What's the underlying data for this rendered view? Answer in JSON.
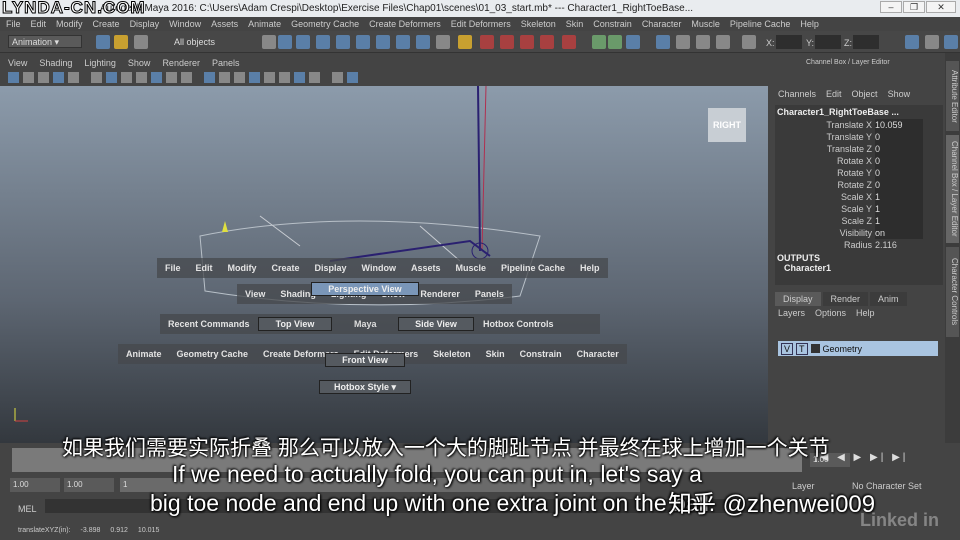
{
  "watermark": "LYNDA-CN.COM",
  "title": "Autodesk Maya 2016: C:\\Users\\Adam Crespi\\Desktop\\Exercise Files\\Chap01\\scenes\\01_03_start.mb*  ---  Character1_RightToeBase...",
  "window_buttons": [
    "–",
    "❐",
    "✕"
  ],
  "menu": [
    "File",
    "Edit",
    "Modify",
    "Create",
    "Display",
    "Window",
    "Assets",
    "Animate",
    "Geometry Cache",
    "Create Deformers",
    "Edit Deformers",
    "Skeleton",
    "Skin",
    "Constrain",
    "Character",
    "Muscle",
    "Pipeline Cache",
    "Help"
  ],
  "toolbar": {
    "mode": "Animation",
    "selection": "All objects",
    "x_label": "X:",
    "y_label": "Y:",
    "z_label": "Z:"
  },
  "viewport_menu": [
    "View",
    "Shading",
    "Lighting",
    "Show",
    "Renderer",
    "Panels"
  ],
  "viewcube": "RIGHT",
  "hotbox": {
    "row1": [
      "File",
      "Edit",
      "Modify",
      "Create",
      "Display",
      "Window",
      "Assets",
      "Muscle",
      "Pipeline Cache",
      "Help"
    ],
    "row2": [
      "View",
      "Shading",
      "Lighting",
      "Show",
      "Renderer",
      "Panels"
    ],
    "perspective": "Perspective View",
    "recent": "Recent Commands",
    "top": "Top View",
    "center": "Maya",
    "side": "Side View",
    "controls": "Hotbox Controls",
    "row4": [
      "Animate",
      "Geometry Cache",
      "Create Deformers",
      "Edit Deformers",
      "Skeleton",
      "Skin",
      "Constrain",
      "Character"
    ],
    "front": "Front View",
    "style": "Hotbox Style"
  },
  "channel_box": {
    "title": "Channel Box / Layer Editor",
    "menu": [
      "Channels",
      "Edit",
      "Object",
      "Show"
    ],
    "object": "Character1_RightToeBase ...",
    "attrs": [
      [
        "Translate X",
        "10.059"
      ],
      [
        "Translate Y",
        "0"
      ],
      [
        "Translate Z",
        "0"
      ],
      [
        "Rotate X",
        "0"
      ],
      [
        "Rotate Y",
        "0"
      ],
      [
        "Rotate Z",
        "0"
      ],
      [
        "Scale X",
        "1"
      ],
      [
        "Scale Y",
        "1"
      ],
      [
        "Scale Z",
        "1"
      ],
      [
        "Visibility",
        "on"
      ]
    ],
    "radius_label": "Radius",
    "radius": "2.116",
    "outputs": "OUTPUTS",
    "output_item": "Character1"
  },
  "layer_editor": {
    "tabs": [
      "Display",
      "Render",
      "Anim"
    ],
    "menu": [
      "Layers",
      "Options",
      "Help"
    ],
    "layer": {
      "v": "V",
      "t": "T",
      "name": "Geometry"
    }
  },
  "side_tabs": [
    "Attribute Editor",
    "Channel Box / Layer Editor",
    "Character Controls"
  ],
  "bottom": {
    "start": "1.00",
    "start2": "1.00",
    "frame": "1",
    "end_field": "1.00",
    "layer": "Layer",
    "char_set": "No Character Set",
    "mel": "MEL",
    "status": "translateXYZ(in):",
    "sx": "-3.898",
    "sy": "0.912",
    "sz": "10.015"
  },
  "subtitles": {
    "zh": "如果我们需要实际折叠 那么可以放入一个大的脚趾节点 并最终在球上增加一个关节",
    "en1": "If we need to actually fold, you can put in, let's say a",
    "en2": "big toe node and end up with one extra joint on the ball."
  },
  "zhihu": "知乎 @zhenwei009",
  "linkedin": "Linked in"
}
